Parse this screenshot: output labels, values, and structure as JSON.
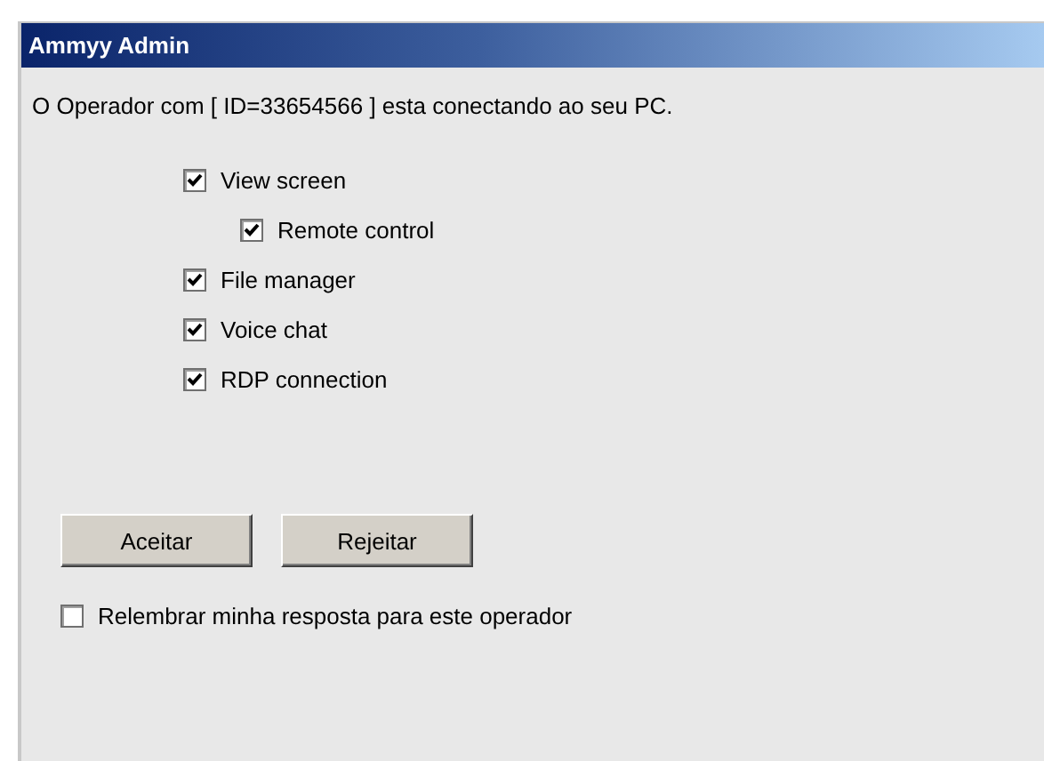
{
  "window": {
    "title": "Ammyy Admin"
  },
  "message": "O Operador com [ ID=33654566 ] esta conectando ao seu PC.",
  "permissions": [
    {
      "label": "View screen",
      "checked": true,
      "children": [
        {
          "label": "Remote control",
          "checked": true
        }
      ]
    },
    {
      "label": "File manager",
      "checked": true
    },
    {
      "label": "Voice chat",
      "checked": true
    },
    {
      "label": "RDP connection",
      "checked": true
    }
  ],
  "buttons": [
    "Aceitar",
    "Rejeitar"
  ],
  "remember": {
    "label": "Relembrar minha resposta para este operador",
    "checked": false
  }
}
